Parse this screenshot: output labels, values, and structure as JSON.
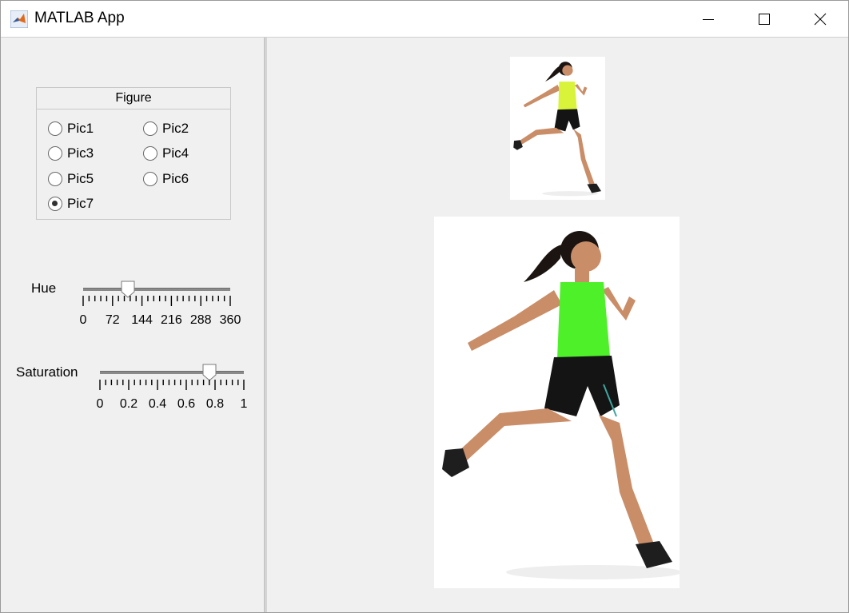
{
  "window": {
    "title": "MATLAB App",
    "icon": "matlab-icon",
    "controls": [
      "minimize-icon",
      "maximize-icon",
      "close-icon"
    ]
  },
  "figure_group": {
    "title": "Figure",
    "options": [
      {
        "label": "Pic1",
        "checked": false
      },
      {
        "label": "Pic2",
        "checked": false
      },
      {
        "label": "Pic3",
        "checked": false
      },
      {
        "label": "Pic4",
        "checked": false
      },
      {
        "label": "Pic5",
        "checked": false
      },
      {
        "label": "Pic6",
        "checked": false
      },
      {
        "label": "Pic7",
        "checked": true
      }
    ]
  },
  "hue": {
    "label": "Hue",
    "min": 0,
    "max": 360,
    "value": 110,
    "tick_labels": [
      "0",
      "72",
      "144",
      "216",
      "288",
      "360"
    ]
  },
  "saturation": {
    "label": "Saturation",
    "min": 0,
    "max": 1,
    "value": 0.76,
    "tick_labels": [
      "0",
      "0.2",
      "0.4",
      "0.6",
      "0.8",
      "1"
    ]
  },
  "images": {
    "original": {
      "name": "runner-original",
      "top_color": "#d9f23a"
    },
    "adjusted": {
      "name": "runner-adjusted",
      "top_color": "#4ef02a"
    }
  },
  "colors": {
    "window_bg": "#f0f0f0",
    "titlebar_bg": "#ffffff"
  }
}
